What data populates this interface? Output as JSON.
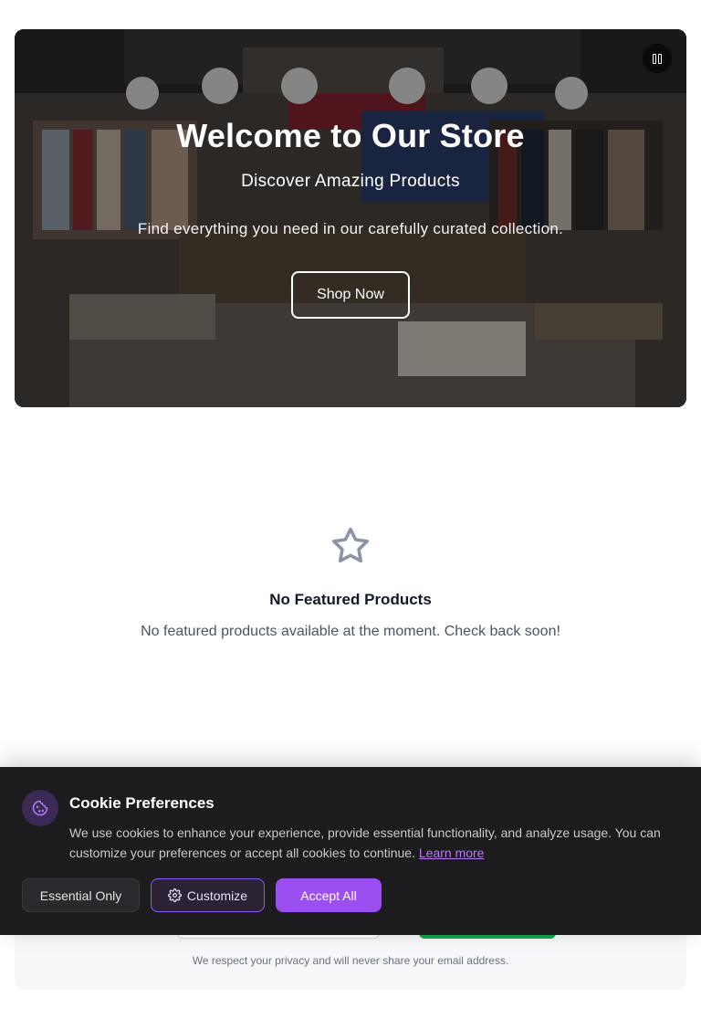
{
  "hero": {
    "title": "Welcome to Our Store",
    "subtitle": "Discover Amazing Products",
    "description": "Find everything you need in our carefully curated collection.",
    "cta_label": "Shop Now",
    "pause_icon": "pause-icon"
  },
  "featured": {
    "icon": "star-icon",
    "title": "No Featured Products",
    "message": "No featured products available at the moment. Check back soon!"
  },
  "newsletter": {
    "privacy_note": "We respect your privacy and will never share your email address."
  },
  "cookie_banner": {
    "icon": "cookie-icon",
    "title": "Cookie Preferences",
    "text": "We use cookies to enhance your experience, provide essential functionality, and analyze usage. You can customize your preferences or accept all cookies to continue.",
    "learn_more": "Learn more",
    "essential_label": "Essential Only",
    "customize_label": "Customize",
    "accept_label": "Accept All",
    "colors": {
      "background": "#1c1c1f",
      "accent": "#9b4ff0",
      "link": "#b57bf2"
    }
  }
}
